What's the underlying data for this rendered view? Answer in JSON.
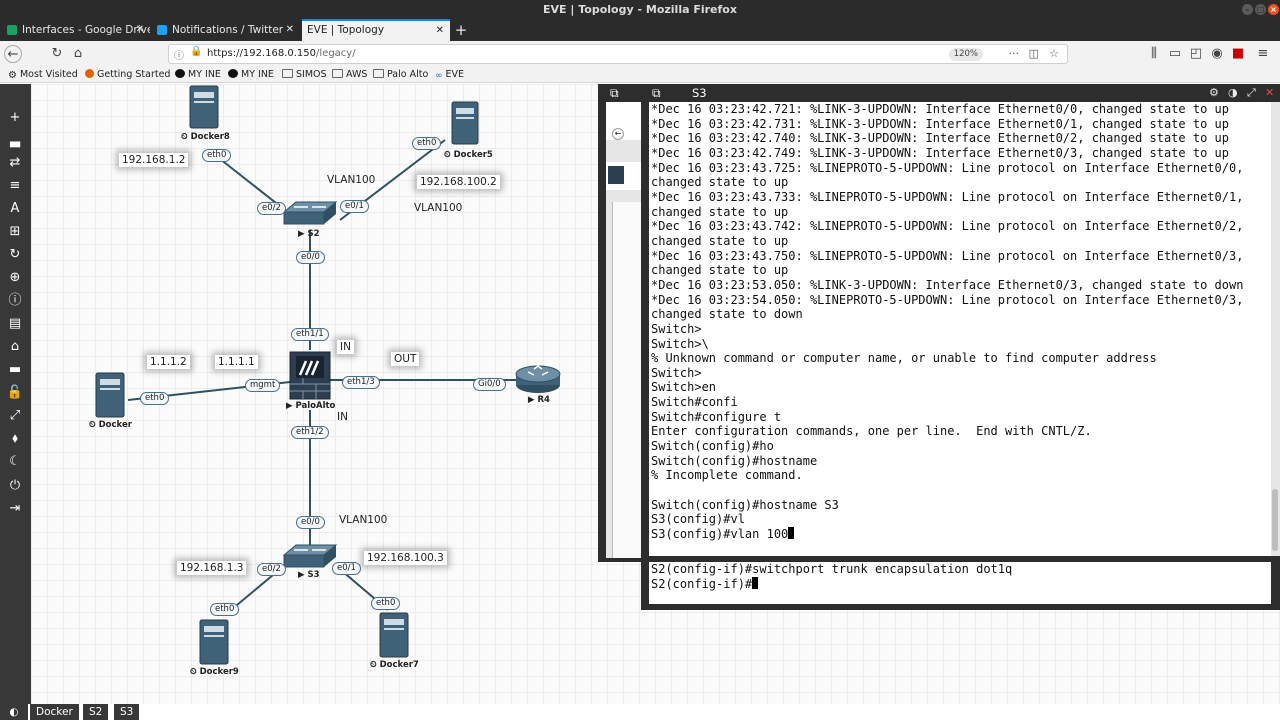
{
  "window": {
    "title": "EVE | Topology - Mozilla Firefox"
  },
  "tabs": [
    {
      "label": "Interfaces - Google Drive",
      "favicon_color": "#1aa260"
    },
    {
      "label": "Notifications / Twitter",
      "favicon_color": "#1da1f2"
    },
    {
      "label": "EVE | Topology",
      "favicon_color": "#ffffff"
    }
  ],
  "navbar": {
    "url_host": "https://192.168.0.150",
    "url_path": "/legacy/",
    "zoom": "120%"
  },
  "bookmarks": [
    {
      "label": "Most Visited",
      "icon": "gear-icon"
    },
    {
      "label": "Getting Started",
      "icon": "firefox-icon"
    },
    {
      "label": "MY INE",
      "icon": "ine-icon"
    },
    {
      "label": "MY INE",
      "icon": "ine-icon"
    },
    {
      "label": "SIMOS",
      "icon": "folder-icon"
    },
    {
      "label": "AWS",
      "icon": "folder-icon"
    },
    {
      "label": "Palo Alto",
      "icon": "folder-icon"
    },
    {
      "label": "EVE",
      "icon": "eve-icon"
    }
  ],
  "topology": {
    "nodes": [
      {
        "id": "docker8",
        "label": "Docker8",
        "type": "server"
      },
      {
        "id": "docker5",
        "label": "Docker5",
        "type": "server"
      },
      {
        "id": "s2",
        "label": "S2",
        "type": "switch"
      },
      {
        "id": "paloalto",
        "label": "PaloAlto",
        "type": "firewall"
      },
      {
        "id": "docker",
        "label": "Docker",
        "type": "server"
      },
      {
        "id": "r4",
        "label": "R4",
        "type": "router"
      },
      {
        "id": "s3",
        "label": "S3",
        "type": "switch"
      },
      {
        "id": "docker9",
        "label": "Docker9",
        "type": "server"
      },
      {
        "id": "docker7",
        "label": "Docker7",
        "type": "server"
      }
    ],
    "interfaces": {
      "docker8_eth0": "eth0",
      "s2_e0_2": "e0/2",
      "docker5_eth0": "eth0",
      "s2_e0_1": "e0/1",
      "s2_e0_0": "e0/0",
      "pa_eth1_1": "eth1/1",
      "pa_mgmt": "mgmt",
      "docker_eth0": "eth0",
      "pa_eth1_3": "eth1/3",
      "r4_gi0_0": "Gi0/0",
      "pa_eth1_2": "eth1/2",
      "s3_e0_0": "e0/0",
      "s3_e0_2": "e0/2",
      "docker9_eth0": "eth0",
      "s3_e0_1": "e0/1",
      "docker7_eth0": "eth0"
    },
    "notes": {
      "ip_docker8": "192.168.1.2",
      "ip_docker5": "192.168.100.2",
      "ip_docker_a": "1.1.1.2",
      "ip_docker_b": "1.1.1.1",
      "in_label": "IN",
      "out_label": "OUT",
      "ip_docker9": "192.168.1.3",
      "ip_docker7": "192.168.100.3"
    },
    "text_labels": {
      "vlan_s2_a": "VLAN100",
      "vlan_s2_b": "VLAN100",
      "in_text": "IN",
      "vlan_s3": "VLAN100"
    }
  },
  "bottom_tabs": [
    "Docker",
    "S2",
    "S3"
  ],
  "console_s3": {
    "title": "S3",
    "lines": [
      "*Dec 16 03:23:42.721: %LINK-3-UPDOWN: Interface Ethernet0/0, changed state to up",
      "*Dec 16 03:23:42.731: %LINK-3-UPDOWN: Interface Ethernet0/1, changed state to up",
      "*Dec 16 03:23:42.740: %LINK-3-UPDOWN: Interface Ethernet0/2, changed state to up",
      "*Dec 16 03:23:42.749: %LINK-3-UPDOWN: Interface Ethernet0/3, changed state to up",
      "*Dec 16 03:23:43.725: %LINEPROTO-5-UPDOWN: Line protocol on Interface Ethernet0/0,",
      "changed state to up",
      "*Dec 16 03:23:43.733: %LINEPROTO-5-UPDOWN: Line protocol on Interface Ethernet0/1,",
      "changed state to up",
      "*Dec 16 03:23:43.742: %LINEPROTO-5-UPDOWN: Line protocol on Interface Ethernet0/2,",
      "changed state to up",
      "*Dec 16 03:23:43.750: %LINEPROTO-5-UPDOWN: Line protocol on Interface Ethernet0/3,",
      "changed state to up",
      "*Dec 16 03:23:53.050: %LINK-3-UPDOWN: Interface Ethernet0/3, changed state to down",
      "*Dec 16 03:23:54.050: %LINEPROTO-5-UPDOWN: Line protocol on Interface Ethernet0/3,",
      "changed state to down",
      "Switch>",
      "Switch>\\",
      "% Unknown command or computer name, or unable to find computer address",
      "Switch>",
      "Switch>en",
      "Switch#confi",
      "Switch#configure t",
      "Enter configuration commands, one per line.  End with CNTL/Z.",
      "Switch(config)#ho",
      "Switch(config)#hostname",
      "% Incomplete command.",
      "",
      "Switch(config)#hostname S3",
      "S3(config)#vl",
      "S3(config)#vlan 100"
    ]
  },
  "console_s2": {
    "lines": [
      "S2(config-if)#switchport trunk encapsulation dot1q",
      "S2(config-if)#"
    ]
  }
}
